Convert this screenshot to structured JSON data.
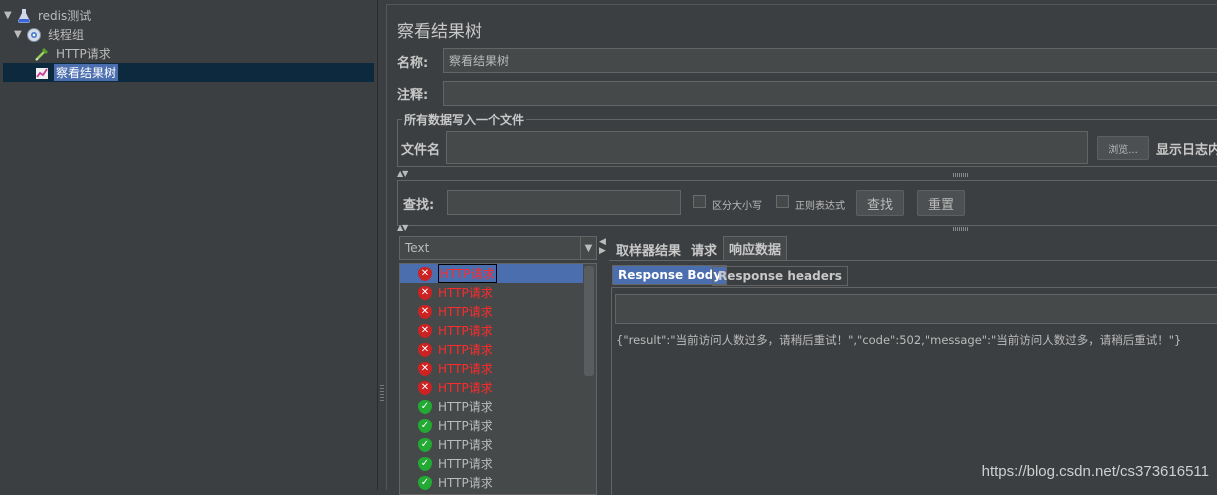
{
  "tree": {
    "items": [
      {
        "label": "redis测试",
        "icon": "flask-icon"
      },
      {
        "label": "线程组",
        "icon": "gear-icon"
      },
      {
        "label": "HTTP请求",
        "icon": "pipette-icon"
      },
      {
        "label": "察看结果树",
        "icon": "chart-icon"
      }
    ]
  },
  "panel": {
    "title": "察看结果树",
    "name_label": "名称:",
    "name_value": "察看结果树",
    "comment_label": "注释:",
    "comment_value": "",
    "file_group_title": "所有数据写入一个文件",
    "file_label": "文件名",
    "file_value": "",
    "browse_label": "浏览...",
    "log_label": "显示日志内"
  },
  "search": {
    "label": "查找:",
    "value": "",
    "case_label": "区分大小写",
    "regex_label": "正则表达式",
    "find_button": "查找",
    "reset_button": "重置"
  },
  "results": {
    "render_mode": "Text",
    "items": [
      {
        "label": "HTTP请求",
        "status": "error"
      },
      {
        "label": "HTTP请求",
        "status": "error"
      },
      {
        "label": "HTTP请求",
        "status": "error"
      },
      {
        "label": "HTTP请求",
        "status": "error"
      },
      {
        "label": "HTTP请求",
        "status": "error"
      },
      {
        "label": "HTTP请求",
        "status": "error"
      },
      {
        "label": "HTTP请求",
        "status": "error"
      },
      {
        "label": "HTTP请求",
        "status": "success"
      },
      {
        "label": "HTTP请求",
        "status": "success"
      },
      {
        "label": "HTTP请求",
        "status": "success"
      },
      {
        "label": "HTTP请求",
        "status": "success"
      },
      {
        "label": "HTTP请求",
        "status": "success"
      }
    ]
  },
  "tabs": {
    "main": [
      "取样器结果",
      "请求",
      "响应数据"
    ],
    "sub": [
      "Response Body",
      "Response headers"
    ]
  },
  "response": {
    "search_value": "",
    "body": "{\"result\":\"当前访问人数过多，请稍后重试！\",\"code\":502,\"message\":\"当前访问人数过多，请稍后重试！\"}"
  },
  "watermark": "https://blog.csdn.net/cs373616511"
}
